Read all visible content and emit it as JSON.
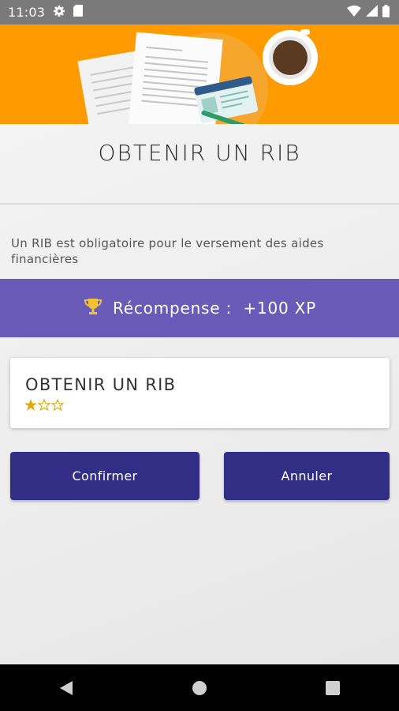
{
  "status_bar": {
    "time": "11:03",
    "icons": [
      "gear-icon",
      "sim-card-icon",
      "wifi-icon",
      "signal-icon",
      "battery-icon"
    ]
  },
  "hero": {
    "image": "documents-id-card-pen-coffee-illustration",
    "background_color": "#ff9a00"
  },
  "page": {
    "title": "OBTENIR UN RIB",
    "description": "Un RIB est obligatoire pour le versement des aides financières"
  },
  "reward": {
    "icon": "trophy-icon",
    "text": "Récompense :  +100 XP",
    "background_color": "#6a5bb8"
  },
  "card": {
    "title": "OBTENIR UN RIB",
    "rating": 1,
    "rating_max": 3
  },
  "buttons": {
    "confirm_label": "Confirmer",
    "cancel_label": "Annuler",
    "color": "#332e85"
  },
  "nav": {
    "icons": [
      "back-icon",
      "home-icon",
      "recents-icon"
    ]
  }
}
